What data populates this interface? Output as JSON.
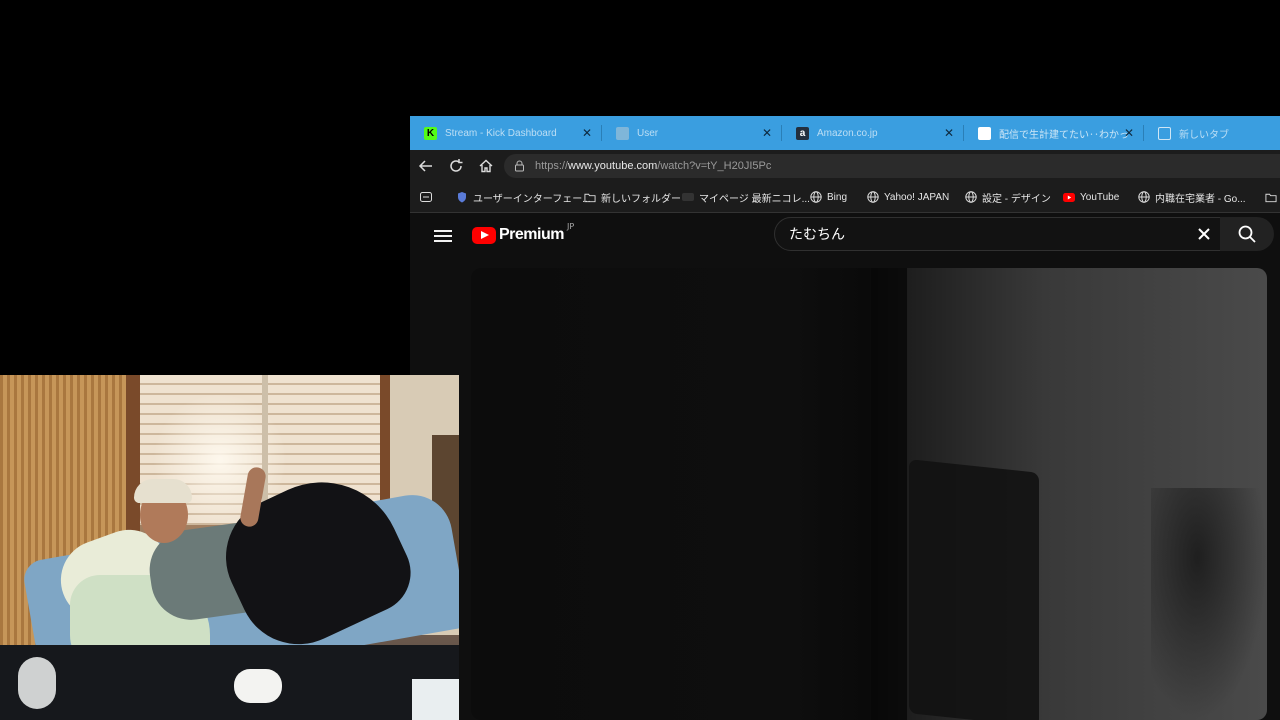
{
  "browser": {
    "tabs": [
      {
        "favicon": "kick-icon",
        "favicon_letter": "K",
        "color": "#53fc18",
        "title": "Stream - Kick Dashboard"
      },
      {
        "favicon": "user-icon",
        "favicon_letter": "",
        "color": "#7fb6d9",
        "title": "User"
      },
      {
        "favicon": "amazon-icon",
        "favicon_letter": "a",
        "color": "#232f3e",
        "title": "Amazon.co.jp"
      },
      {
        "favicon": "document-icon",
        "favicon_letter": "",
        "color": "#ffffff",
        "title": "配信で生計建てたい‥わかってんだ"
      },
      {
        "favicon": "new-tab-icon",
        "favicon_letter": "",
        "color": "#3a9ee0",
        "title": "新しいタブ"
      }
    ],
    "url": {
      "prefix": "https://",
      "host": "www.youtube.com",
      "path": "/watch?v=tY_H20JI5Pc"
    },
    "bookmarks": [
      {
        "icon": "sidebar-icon",
        "label": ""
      },
      {
        "icon": "shield-icon",
        "label": "ユーザーインターフェー..."
      },
      {
        "icon": "folder-icon",
        "label": "新しいフォルダー"
      },
      {
        "icon": "niconico-icon",
        "label": "マイページ 最新ニコレ..."
      },
      {
        "icon": "globe-icon",
        "label": "Bing"
      },
      {
        "icon": "globe-icon",
        "label": "Yahoo! JAPAN"
      },
      {
        "icon": "globe-icon",
        "label": "設定 - デザイン"
      },
      {
        "icon": "youtube-icon",
        "label": "YouTube"
      },
      {
        "icon": "globe-icon",
        "label": "内職在宅業者 - Go..."
      },
      {
        "icon": "folder-icon",
        "label": ""
      }
    ]
  },
  "youtube": {
    "logo_text": "Premium",
    "region": "JP",
    "search_value": "たむちん",
    "brand_color": "#ff0000"
  }
}
